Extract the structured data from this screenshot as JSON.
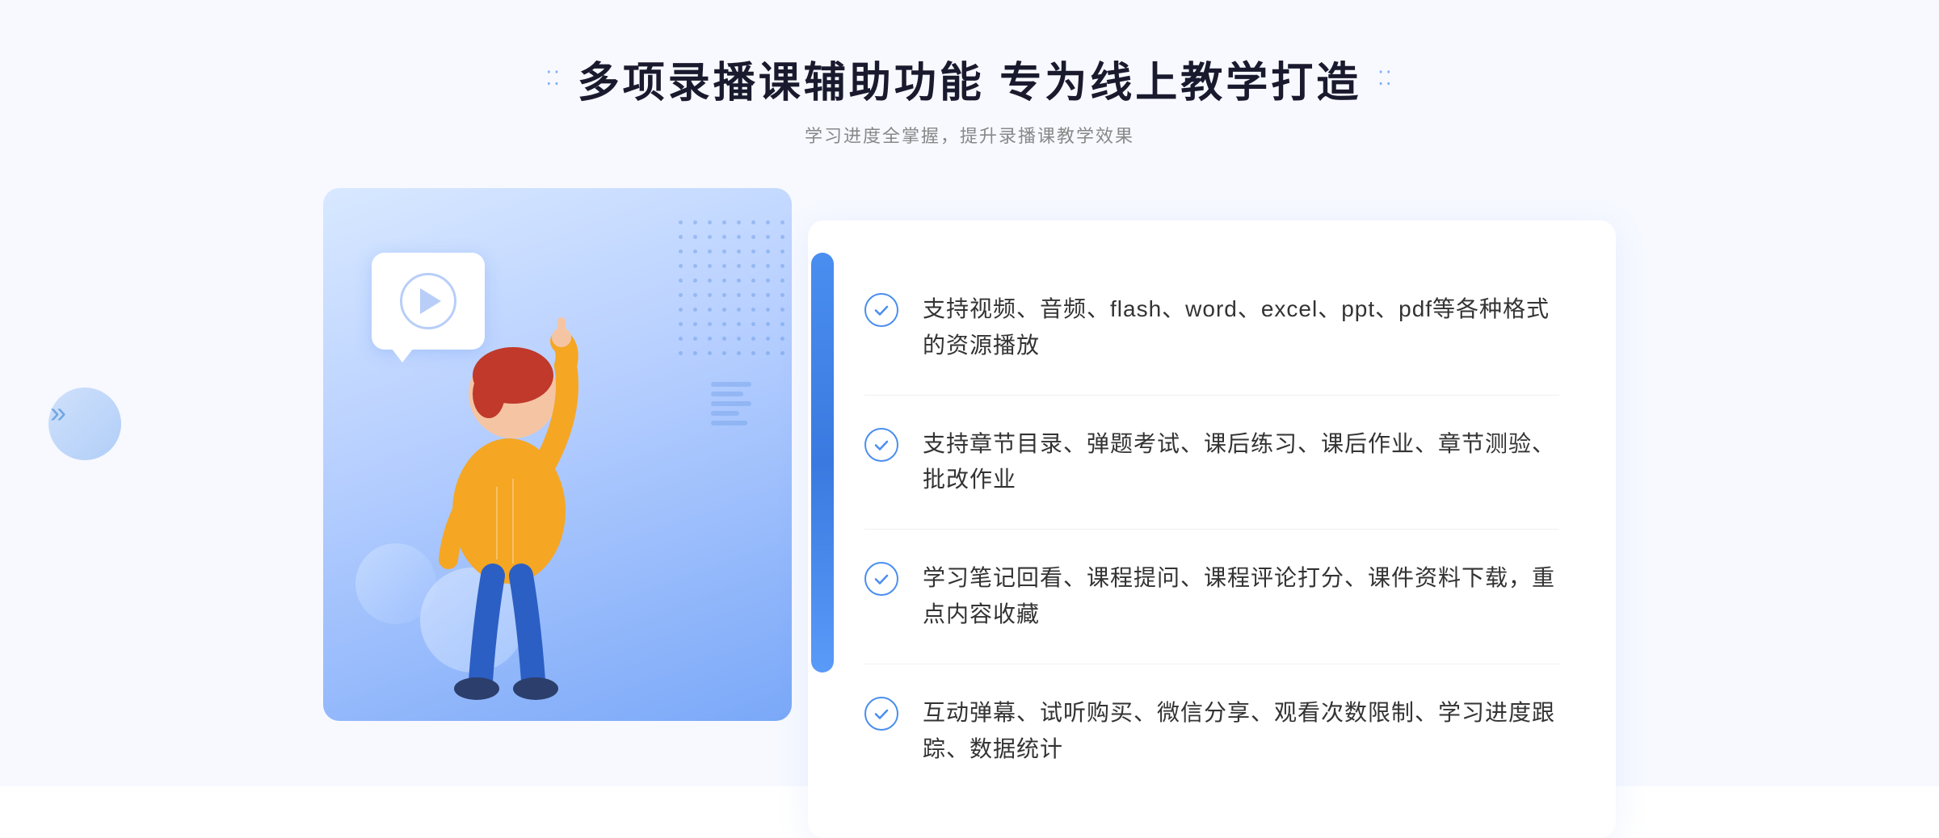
{
  "header": {
    "title": "多项录播课辅助功能 专为线上教学打造",
    "subtitle": "学习进度全掌握，提升录播课教学效果",
    "dots_left": "⁚⁚",
    "dots_right": "⁚⁚"
  },
  "features": [
    {
      "id": 1,
      "text": "支持视频、音频、flash、word、excel、ppt、pdf等各种格式的资源播放"
    },
    {
      "id": 2,
      "text": "支持章节目录、弹题考试、课后练习、课后作业、章节测验、批改作业"
    },
    {
      "id": 3,
      "text": "学习笔记回看、课程提问、课程评论打分、课件资料下载，重点内容收藏"
    },
    {
      "id": 4,
      "text": "互动弹幕、试听购买、微信分享、观看次数限制、学习进度跟踪、数据统计"
    }
  ],
  "illustration": {
    "play_button_alt": "播放按钮"
  },
  "colors": {
    "primary": "#4a8ef0",
    "title": "#1a1a2e",
    "subtitle": "#888888",
    "text": "#333333",
    "bg": "#f7f9ff",
    "card_bg": "#ffffff"
  }
}
